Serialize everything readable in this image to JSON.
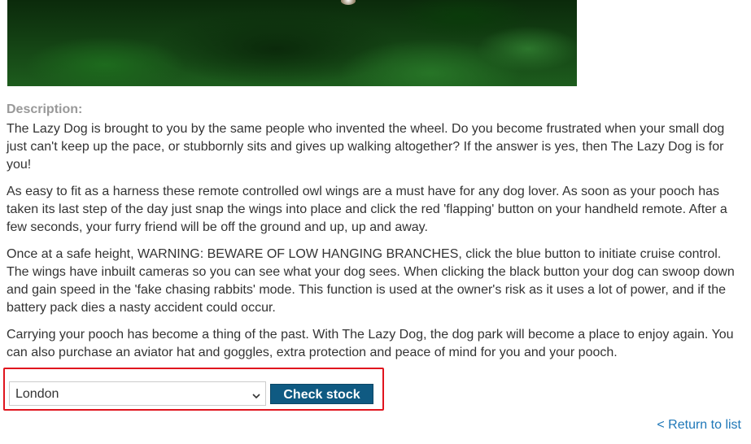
{
  "description": {
    "label": "Description:",
    "paragraphs": [
      "The Lazy Dog is brought to you by the same people who invented the wheel. Do you become frustrated when your small dog just can't keep up the pace, or stubbornly sits and gives up walking altogether? If the answer is yes, then The Lazy Dog is for you!",
      "As easy to fit as a harness these remote controlled owl wings are a must have for any dog lover. As soon as your pooch has taken its last step of the day just snap the wings into place and click the red 'flapping' button on your handheld remote. After a few seconds, your furry friend will be off the ground and up, up and away.",
      "Once at a safe height, WARNING: BEWARE OF LOW HANGING BRANCHES, click the blue button to initiate cruise control. The wings have inbuilt cameras so you can see what your dog sees. When clicking the black button your dog can swoop down and gain speed in the 'fake chasing rabbits' mode. This function is used at the owner's risk as it uses a lot of power, and if the battery pack dies a nasty accident could occur.",
      "Carrying your pooch has become a thing of the past. With The Lazy Dog, the dog park will become a place to enjoy again. You can also purchase an aviator hat and goggles, extra protection and peace of mind for you and your pooch."
    ]
  },
  "stock_check": {
    "selected_store": "London",
    "button_label": "Check stock",
    "highlight_color": "#e0151e",
    "button_color": "#0f5a82"
  },
  "navigation": {
    "return_link": "< Return to list"
  }
}
